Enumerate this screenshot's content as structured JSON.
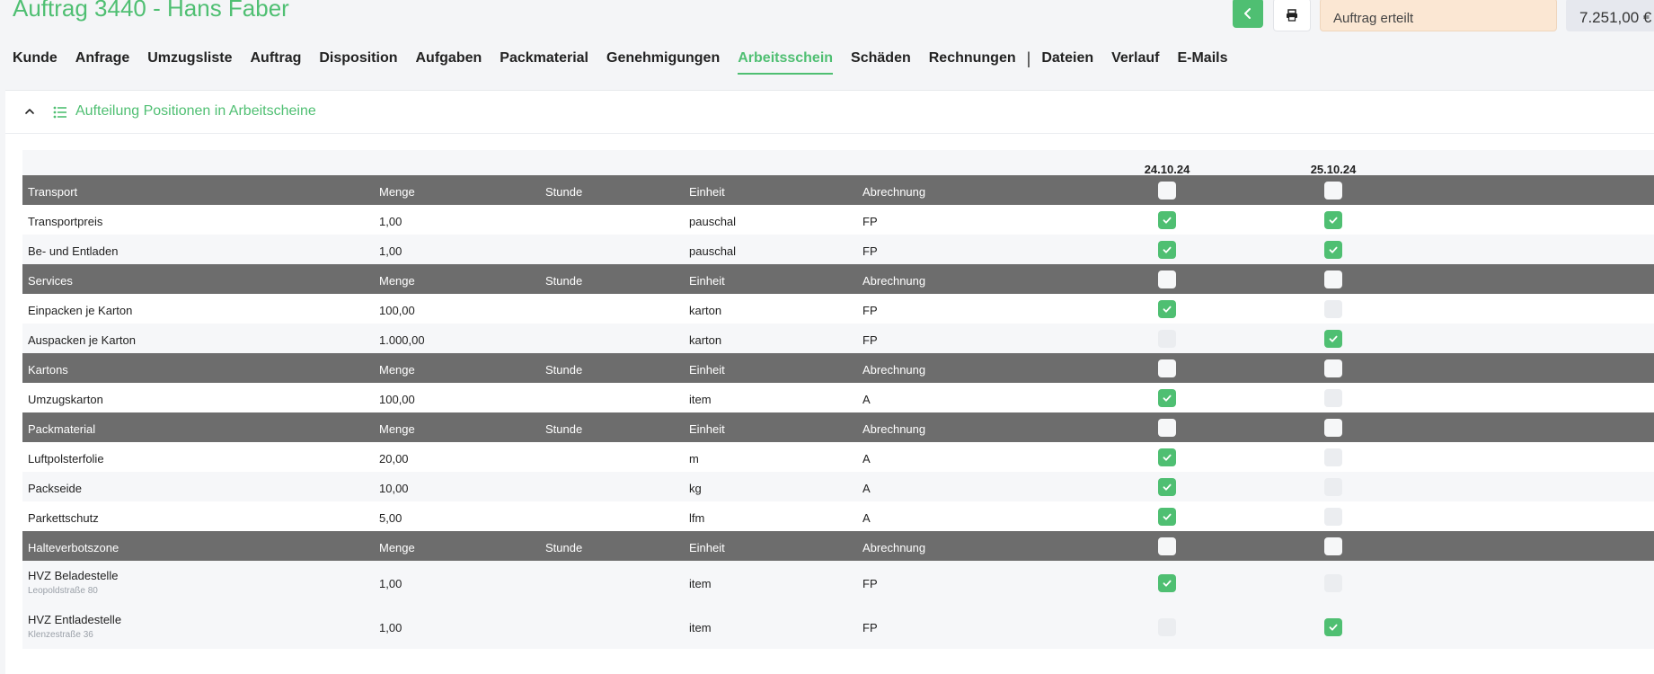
{
  "header": {
    "title": "Auftrag 3440 - Hans Faber",
    "status": "Auftrag erteilt",
    "total": "7.251,00 €",
    "back_icon": "chevron-left-icon",
    "print_icon": "printer-icon",
    "accent": "#4fbf72"
  },
  "nav": {
    "tabs": [
      "Kunde",
      "Anfrage",
      "Umzugsliste",
      "Auftrag",
      "Disposition",
      "Aufgaben",
      "Packmaterial",
      "Genehmigungen",
      "Arbeitsschein",
      "Schäden",
      "Rechnungen",
      "Dateien",
      "Verlauf",
      "E-Mails"
    ],
    "active": "Arbeitsschein",
    "separator": "|"
  },
  "panel": {
    "title": "Aufteilung Positionen in Arbeitscheine"
  },
  "table": {
    "dates": [
      "24.10.24",
      "25.10.24"
    ],
    "groups": [
      {
        "name": "Transport",
        "menge": "Menge",
        "stunde": "Stunde",
        "einheit": "Einheit",
        "abrechnung": "Abrechnung",
        "items": [
          {
            "name": "Transportpreis",
            "menge": "1,00",
            "einheit": "pauschal",
            "abrechnung": "FP",
            "checks": [
              true,
              true
            ]
          },
          {
            "name": "Be- und Entladen",
            "menge": "1,00",
            "einheit": "pauschal",
            "abrechnung": "FP",
            "checks": [
              true,
              true
            ]
          }
        ]
      },
      {
        "name": "Services",
        "menge": "Menge",
        "stunde": "Stunde",
        "einheit": "Einheit",
        "abrechnung": "Abrechnung",
        "items": [
          {
            "name": "Einpacken je Karton",
            "menge": "100,00",
            "einheit": "karton",
            "abrechnung": "FP",
            "checks": [
              true,
              false
            ]
          },
          {
            "name": "Auspacken je Karton",
            "menge": "1.000,00",
            "einheit": "karton",
            "abrechnung": "FP",
            "checks": [
              false,
              true
            ]
          }
        ]
      },
      {
        "name": "Kartons",
        "menge": "Menge",
        "stunde": "Stunde",
        "einheit": "Einheit",
        "abrechnung": "Abrechnung",
        "items": [
          {
            "name": "Umzugskarton",
            "menge": "100,00",
            "einheit": "item",
            "abrechnung": "A",
            "checks": [
              true,
              false
            ]
          }
        ]
      },
      {
        "name": "Packmaterial",
        "menge": "Menge",
        "stunde": "Stunde",
        "einheit": "Einheit",
        "abrechnung": "Abrechnung",
        "items": [
          {
            "name": "Luftpolsterfolie",
            "menge": "20,00",
            "einheit": "m",
            "abrechnung": "A",
            "checks": [
              true,
              false
            ]
          },
          {
            "name": "Packseide",
            "menge": "10,00",
            "einheit": "kg",
            "abrechnung": "A",
            "checks": [
              true,
              false
            ]
          },
          {
            "name": "Parkettschutz",
            "menge": "5,00",
            "einheit": "lfm",
            "abrechnung": "A",
            "checks": [
              true,
              false
            ]
          }
        ]
      },
      {
        "name": "Halteverbotszone",
        "menge": "Menge",
        "stunde": "Stunde",
        "einheit": "Einheit",
        "abrechnung": "Abrechnung",
        "items": [
          {
            "name": "HVZ Beladestelle",
            "sub": "Leopoldstraße 80",
            "menge": "1,00",
            "einheit": "item",
            "abrechnung": "FP",
            "checks": [
              true,
              false
            ]
          },
          {
            "name": "HVZ Entladestelle",
            "sub": "Klenzestraße 36",
            "menge": "1,00",
            "einheit": "item",
            "abrechnung": "FP",
            "checks": [
              false,
              true
            ]
          }
        ]
      }
    ]
  }
}
